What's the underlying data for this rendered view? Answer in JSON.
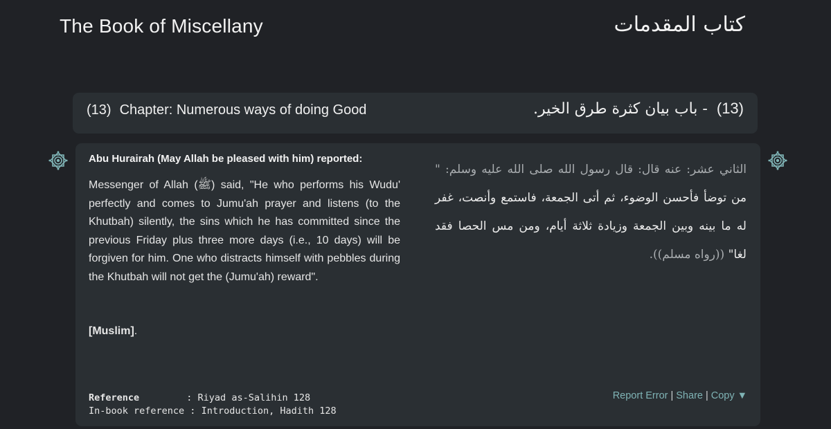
{
  "header": {
    "book_title_en": "The Book of Miscellany",
    "book_title_ar": "كتاب المقدمات"
  },
  "chapter": {
    "number_en": "(13)",
    "title_en": "Chapter: Numerous ways of doing Good",
    "number_ar": "(13)",
    "title_ar": "- باب بيان كثرة طرق الخير."
  },
  "hadith": {
    "narrator_en": "Abu Hurairah (May Allah be pleased with him) reported:",
    "text_en": "Messenger of Allah (ﷺ) said, \"He who performs his Wudu' perfectly and comes to Jumu'ah prayer and listens (to the Khutbah) silently, the sins which he has committed since the previous Friday plus three more days (i.e., 10 days) will be forgiven for him. One who distracts himself with pebbles during the Khutbah will not get the (Jumu'ah) reward\".",
    "grade_label": "[Muslim]",
    "grade_suffix": ".",
    "narrator_ar": "الثاني عشر: عنه قال: قال رسول الله صلى الله عليه وسلم: \"",
    "text_ar": "من توضأ فأحسن الوضوء، ثم أتى الجمعة، فاستمع وأنصت، غفر له ما بينه وبين الجمعة وزيادة ثلاثة أيام، ومن مس الحصا فقد لغا\"",
    "source_ar": "((رواه مسلم)).",
    "reference_label": "Reference",
    "reference_sep": " : ",
    "reference_value": "Riyad as-Salihin 128",
    "inbook_label": "In-book reference",
    "inbook_sep": " : ",
    "inbook_value": "Introduction, Hadith 128"
  },
  "actions": {
    "report_error": "Report Error",
    "share": "Share",
    "copy": "Copy",
    "copy_arrow": "▼",
    "separator": "|"
  },
  "icons": {
    "ornament": "rub-el-hizb-ornament-icon"
  },
  "colors": {
    "background": "#202226",
    "panel": "#2a2f33",
    "link": "#7fb3b5",
    "ornament": "#7fb3b5"
  }
}
